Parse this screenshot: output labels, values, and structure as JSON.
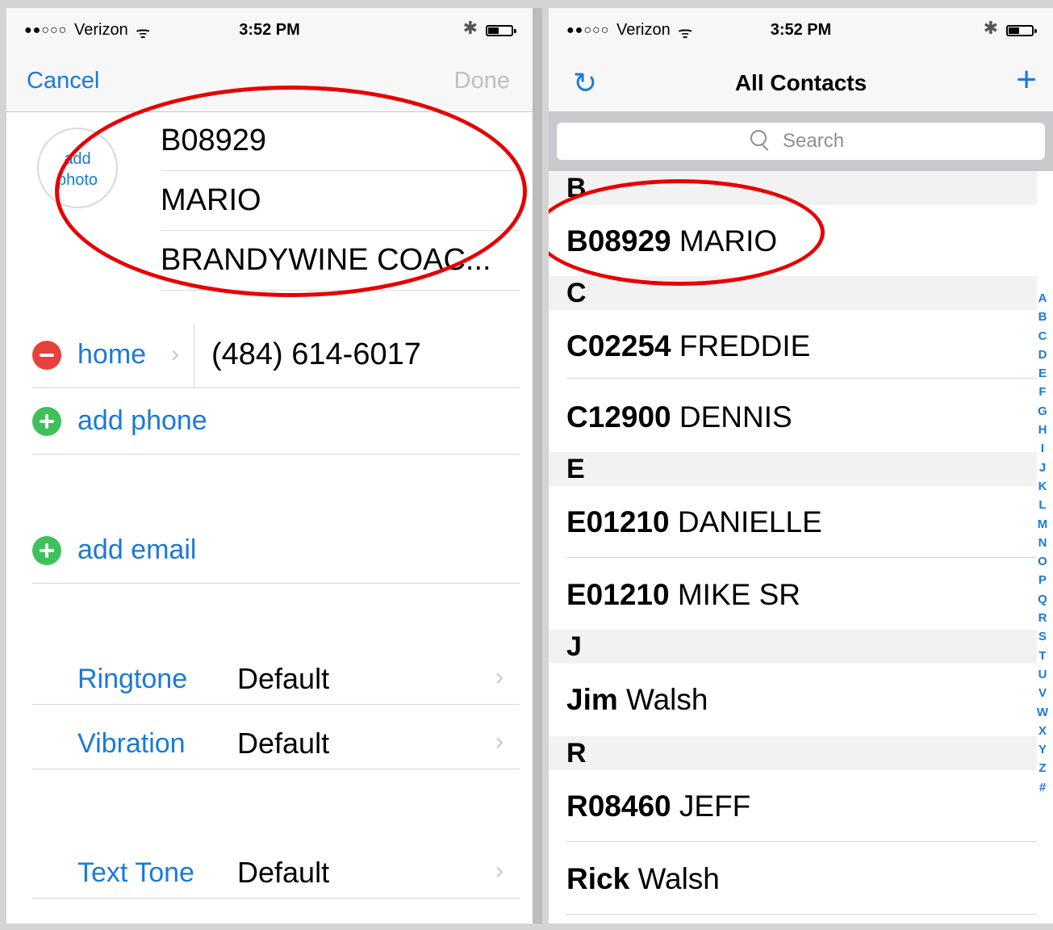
{
  "left": {
    "status": {
      "signal": "●●○○○",
      "carrier": "Verizon",
      "time": "3:52 PM"
    },
    "nav": {
      "cancel": "Cancel",
      "done": "Done"
    },
    "photo_label": "add photo",
    "name_fields": [
      "B08929",
      "MARIO",
      "BRANDYWINE COAC..."
    ],
    "phone": {
      "label": "home",
      "value": "(484) 614-6017"
    },
    "add_phone": "add phone",
    "add_email": "add email",
    "settings": [
      {
        "label": "Ringtone",
        "value": "Default"
      },
      {
        "label": "Vibration",
        "value": "Default"
      },
      {
        "label": "Text Tone",
        "value": "Default"
      }
    ]
  },
  "right": {
    "status": {
      "signal": "●●○○○",
      "carrier": "Verizon",
      "time": "3:52 PM"
    },
    "nav": {
      "title": "All Contacts"
    },
    "search_placeholder": "Search",
    "sections": [
      {
        "letter": "B",
        "contacts": [
          {
            "code": "B08929",
            "name": "MARIO"
          }
        ]
      },
      {
        "letter": "C",
        "contacts": [
          {
            "code": "C02254",
            "name": "FREDDIE"
          },
          {
            "code": "C12900",
            "name": "DENNIS"
          }
        ]
      },
      {
        "letter": "E",
        "contacts": [
          {
            "code": "E01210",
            "name": "DANIELLE"
          },
          {
            "code": "E01210",
            "name": "MIKE SR"
          }
        ]
      },
      {
        "letter": "J",
        "contacts": [
          {
            "code": "Jim",
            "name": "Walsh"
          }
        ]
      },
      {
        "letter": "R",
        "contacts": [
          {
            "code": "R08460",
            "name": "JEFF"
          },
          {
            "code": "Rick",
            "name": "Walsh"
          }
        ]
      }
    ],
    "index": [
      "A",
      "B",
      "C",
      "D",
      "E",
      "F",
      "G",
      "H",
      "I",
      "J",
      "K",
      "L",
      "M",
      "N",
      "O",
      "P",
      "Q",
      "R",
      "S",
      "T",
      "U",
      "V",
      "W",
      "X",
      "Y",
      "Z",
      "#"
    ]
  },
  "colors": {
    "ios_blue": "#1a7ad8",
    "annotation_red": "#e80000",
    "delete_red": "#e8403a",
    "add_green": "#3ec15a"
  },
  "battery_level": 0.45
}
